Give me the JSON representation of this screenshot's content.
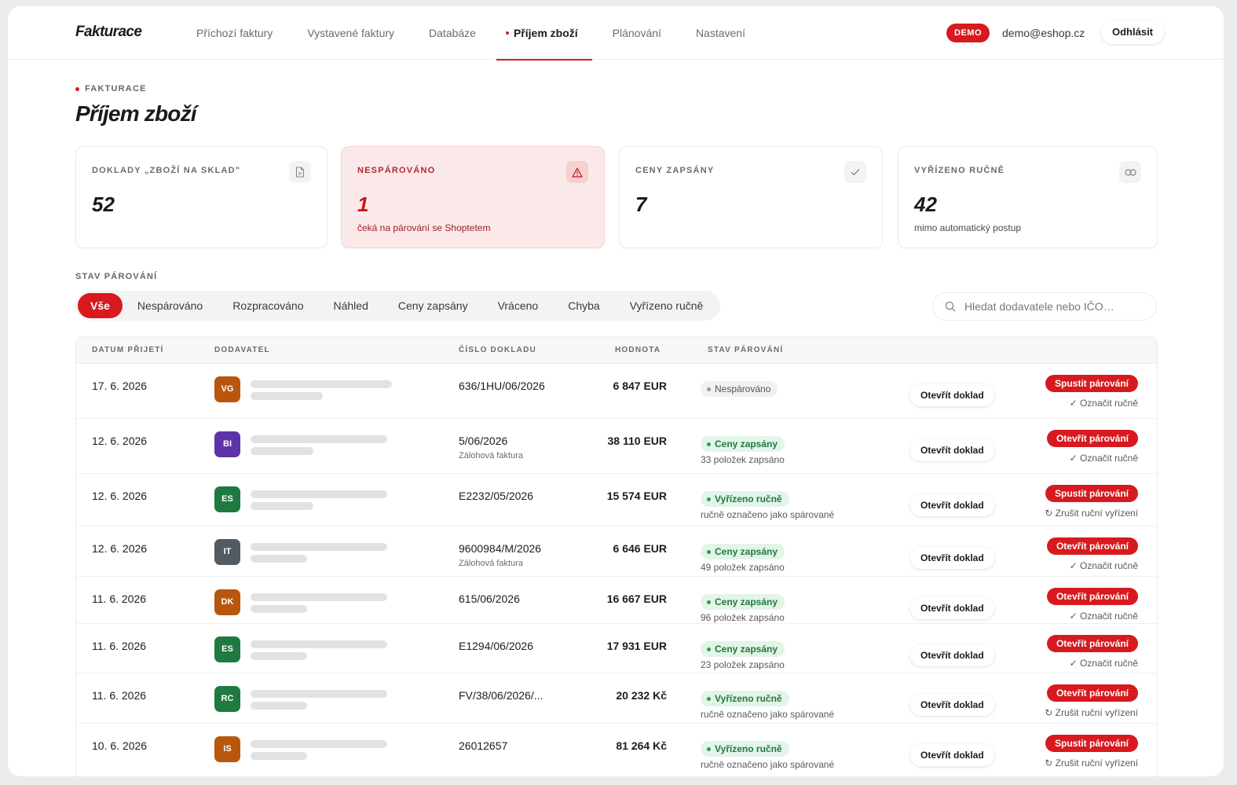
{
  "app": {
    "logo": "Fakturace"
  },
  "nav": [
    {
      "label": "Příchozí faktury"
    },
    {
      "label": "Vystavené faktury"
    },
    {
      "label": "Databáze"
    },
    {
      "label": "Příjem zboží"
    },
    {
      "label": "Plánování"
    },
    {
      "label": "Nastavení"
    }
  ],
  "header": {
    "demo_badge": "DEMO",
    "email": "demo@eshop.cz",
    "logout": "Odhlásit"
  },
  "page": {
    "eyebrow": "FAKTURACE",
    "title": "Příjem zboží"
  },
  "cards": [
    {
      "label": "DOKLADY „ZBOŽÍ NA SKLAD\"",
      "value": "52",
      "sub": "",
      "icon": "document-icon"
    },
    {
      "label": "NESPÁROVÁNO",
      "value": "1",
      "sub": "čeká na párování se Shoptetem",
      "icon": "warning-icon"
    },
    {
      "label": "CENY ZAPSÁNY",
      "value": "7",
      "sub": "",
      "icon": "check-icon"
    },
    {
      "label": "VYŘÍZENO RUČNĚ",
      "value": "42",
      "sub": "mimo automatický postup",
      "icon": "link-icon"
    }
  ],
  "filter": {
    "label": "STAV PÁROVÁNÍ",
    "chips": [
      "Vše",
      "Nespárováno",
      "Rozpracováno",
      "Náhled",
      "Ceny zapsány",
      "Vráceno",
      "Chyba",
      "Vyřízeno ručně"
    ],
    "active": "Vše"
  },
  "search": {
    "placeholder": "Hledat dodavatele nebo IČO…",
    "value": ""
  },
  "table": {
    "headers": [
      "DATUM PŘIJETÍ",
      "DODAVATEL",
      "ČÍSLO DOKLADU",
      "HODNOTA",
      "STAV PÁROVÁNÍ"
    ],
    "open_label": "Otevřít doklad",
    "rows": [
      {
        "date": "17. 6. 2026",
        "initials": "VG",
        "avatar_color": "#b8560d",
        "doc": "636/1HU/06/2026",
        "doc_type": "",
        "amount": "6 847 EUR",
        "status": "Nespárováno",
        "status_kind": "grey",
        "status_sub": "",
        "action": "Spustit párování",
        "secondary": "✓ Označit ručně"
      },
      {
        "date": "12. 6. 2026",
        "initials": "BI",
        "avatar_color": "#5c34a8",
        "doc": "5/06/2026",
        "doc_type": "Zálohová faktura",
        "amount": "38 110 EUR",
        "status": "Ceny zapsány",
        "status_kind": "green",
        "status_sub": "33 položek zapsáno",
        "action": "Otevřít párování",
        "secondary": "✓ Označit ručně"
      },
      {
        "date": "12. 6. 2026",
        "initials": "ES",
        "avatar_color": "#1f7a3f",
        "doc": "E2232/05/2026",
        "doc_type": "",
        "amount": "15 574 EUR",
        "status": "Vyřízeno ručně",
        "status_kind": "green",
        "status_sub": "ručně označeno jako spárované",
        "action": "Spustit párování",
        "secondary": "↻ Zrušit ruční vyřízení"
      },
      {
        "date": "12. 6. 2026",
        "initials": "IT",
        "avatar_color": "#535a62",
        "doc": "9600984/M/2026",
        "doc_type": "Zálohová faktura",
        "amount": "6 646 EUR",
        "status": "Ceny zapsány",
        "status_kind": "green",
        "status_sub": "49 položek zapsáno",
        "action": "Otevřít párování",
        "secondary": "✓ Označit ručně"
      },
      {
        "date": "11. 6. 2026",
        "initials": "DK",
        "avatar_color": "#b8560d",
        "doc": "615/06/2026",
        "doc_type": "",
        "amount": "16 667 EUR",
        "status": "Ceny zapsány",
        "status_kind": "green",
        "status_sub": "96 položek zapsáno",
        "action": "Otevřít párování",
        "secondary": "✓ Označit ručně"
      },
      {
        "date": "11. 6. 2026",
        "initials": "ES",
        "avatar_color": "#1f7a3f",
        "doc": "E1294/06/2026",
        "doc_type": "",
        "amount": "17 931 EUR",
        "status": "Ceny zapsány",
        "status_kind": "green",
        "status_sub": "23 položek zapsáno",
        "action": "Otevřít párování",
        "secondary": "✓ Označit ručně"
      },
      {
        "date": "11. 6. 2026",
        "initials": "RC",
        "avatar_color": "#1f7a3f",
        "doc": "FV/38/06/2026/...",
        "doc_type": "",
        "amount": "20 232 Kč",
        "status": "Vyřízeno ručně",
        "status_kind": "green",
        "status_sub": "ručně označeno jako spárované",
        "action": "Otevřít párování",
        "secondary": "↻ Zrušit ruční vyřízení"
      },
      {
        "date": "10. 6. 2026",
        "initials": "IS",
        "avatar_color": "#b8560d",
        "doc": "26012657",
        "doc_type": "",
        "amount": "81 264 Kč",
        "status": "Vyřízeno ručně",
        "status_kind": "green",
        "status_sub": "ručně označeno jako spárované",
        "action": "Spustit párování",
        "secondary": "↻ Zrušit ruční vyřízení"
      }
    ]
  },
  "colors": {
    "accent": "#d71a1f",
    "alert_bg": "#fbe9e9",
    "success_bg": "#e3f4e8",
    "success_text": "#1f7a3f"
  }
}
